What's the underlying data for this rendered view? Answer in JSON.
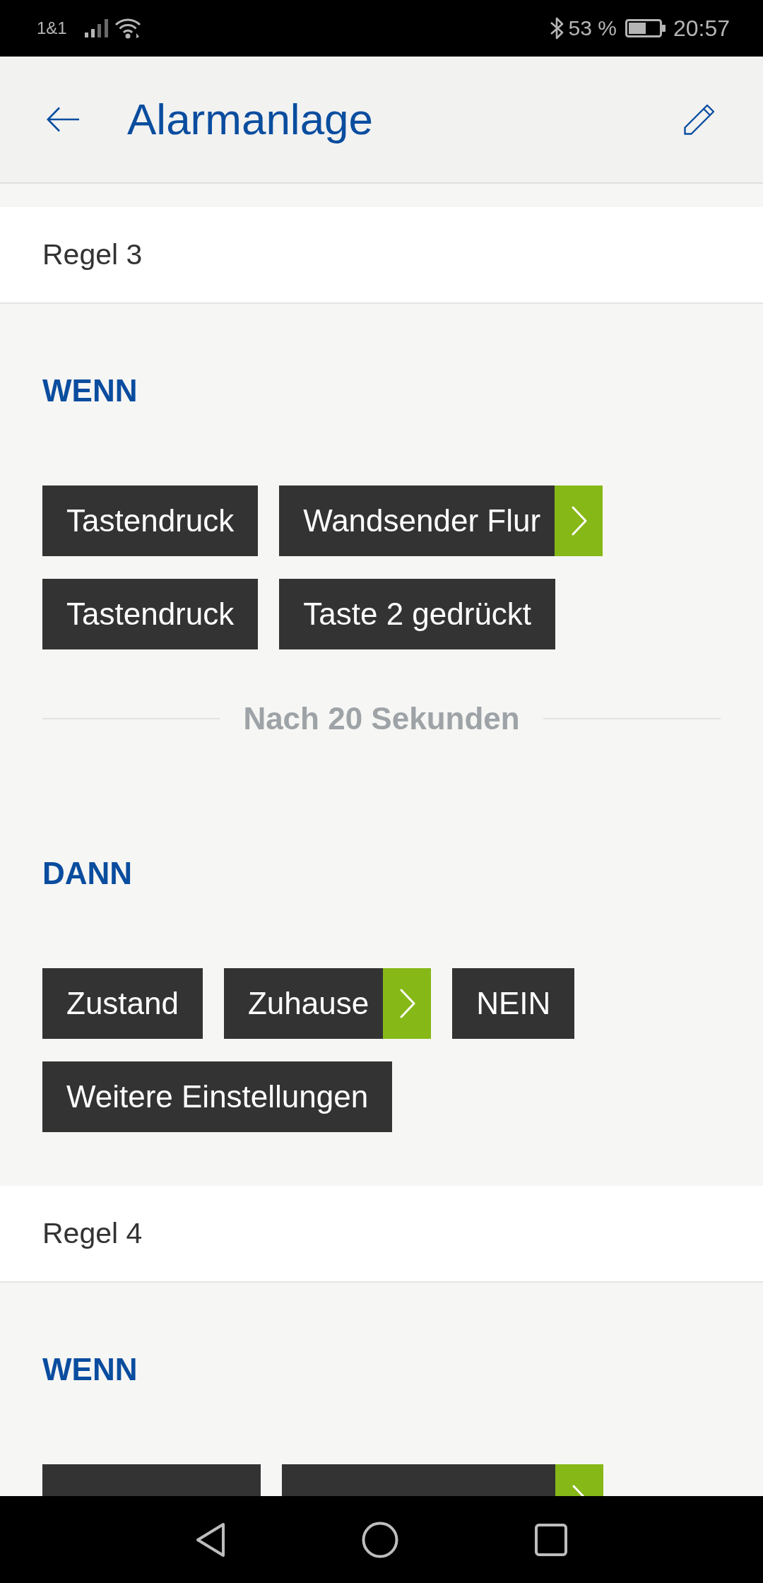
{
  "status_bar": {
    "carrier": "1&1",
    "battery": "53 %",
    "time": "20:57"
  },
  "header": {
    "title": "Alarmanlage"
  },
  "rules": [
    {
      "title": "Regel 3",
      "blocks": [
        {
          "kind": "group",
          "heading": "WENN",
          "rows": [
            {
              "chips": [
                {
                  "label": "Tastendruck",
                  "kind": "plain"
                },
                {
                  "label": "Wandsender Flur",
                  "kind": "select"
                }
              ]
            },
            {
              "chips": [
                {
                  "label": "Tastendruck",
                  "kind": "plain"
                },
                {
                  "label": "Taste 2 gedrückt",
                  "kind": "plain"
                }
              ]
            }
          ]
        },
        {
          "kind": "delay",
          "label": "Nach 20 Sekunden"
        },
        {
          "kind": "group",
          "heading": "DANN",
          "rows": [
            {
              "chips": [
                {
                  "label": "Zustand",
                  "kind": "plain"
                },
                {
                  "label": "Zuhause",
                  "kind": "select"
                },
                {
                  "label": "NEIN",
                  "kind": "plain"
                }
              ]
            },
            {
              "chips": [
                {
                  "label": "Weitere Einstellungen",
                  "kind": "plain"
                }
              ]
            }
          ]
        }
      ]
    },
    {
      "title": "Regel 4",
      "blocks": [
        {
          "kind": "group",
          "heading": "WENN",
          "rows": [
            {
              "chips": [
                {
                  "kind": "plain"
                },
                {
                  "kind": "select"
                }
              ]
            }
          ]
        }
      ]
    }
  ]
}
